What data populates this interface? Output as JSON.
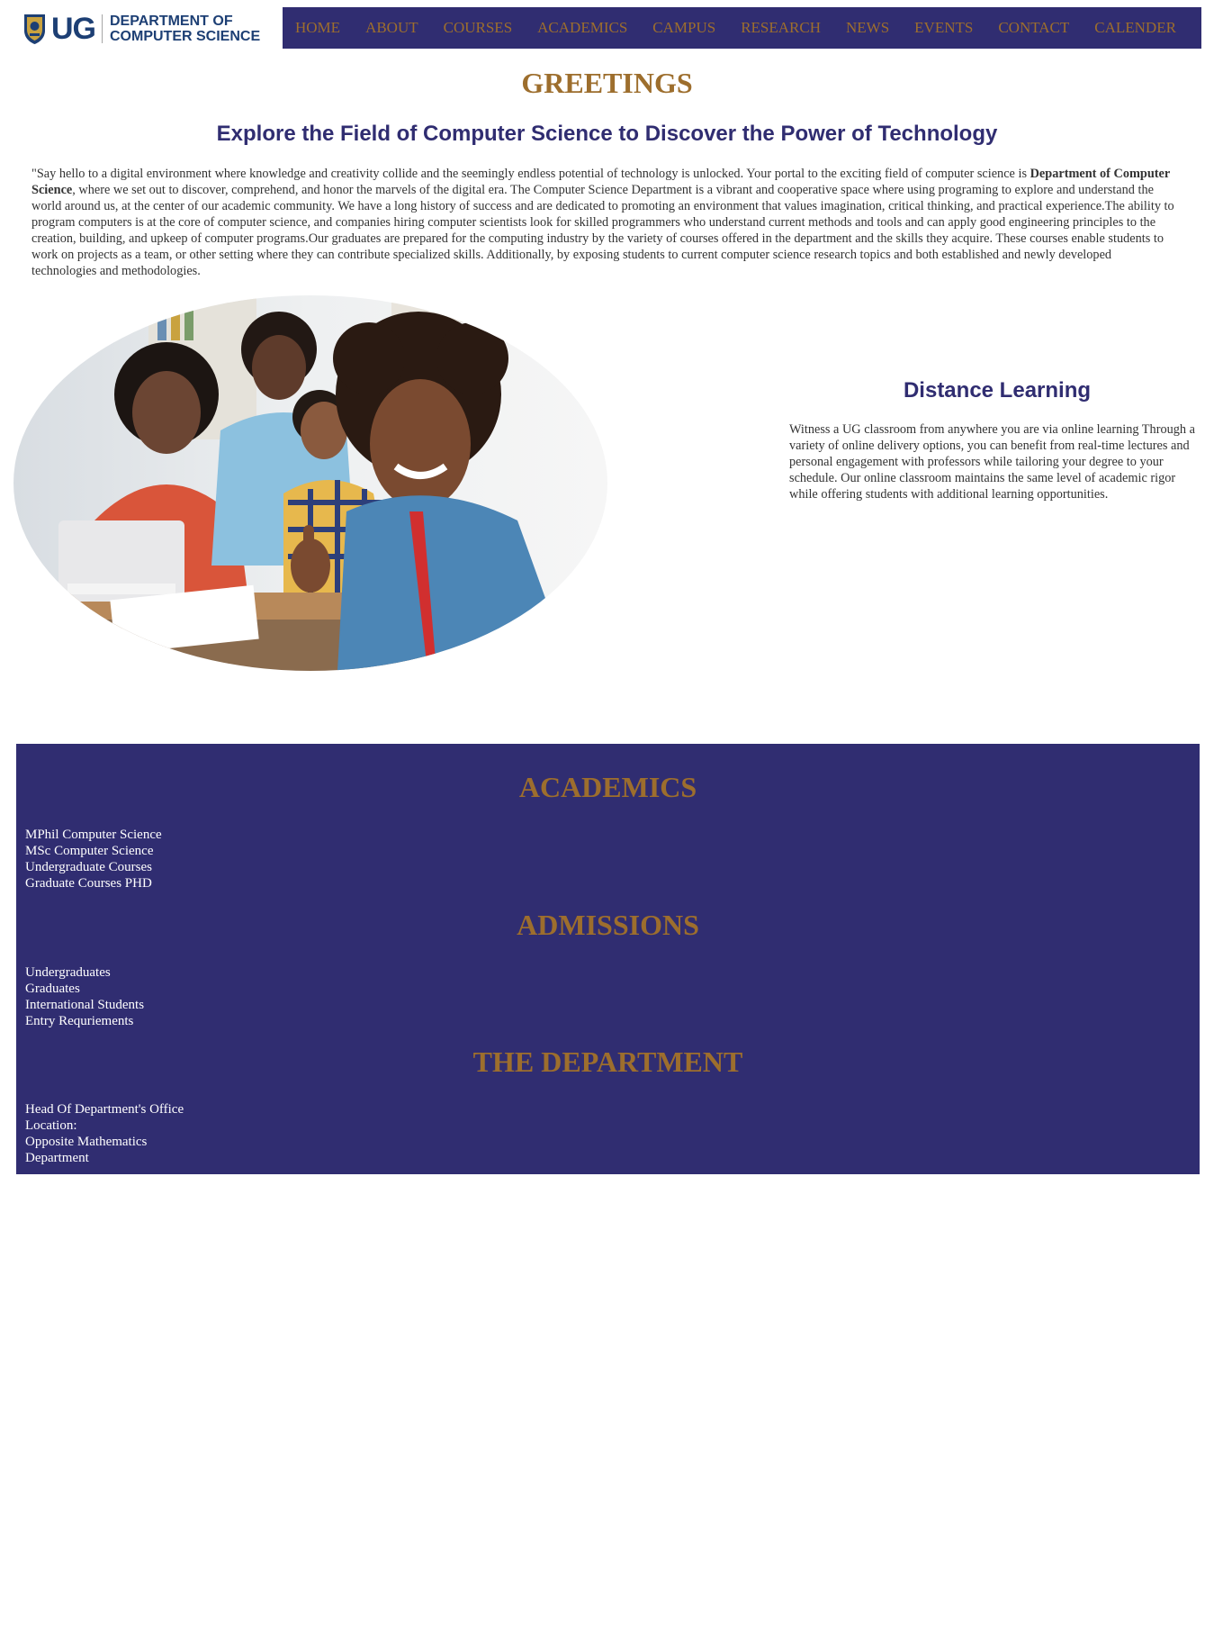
{
  "logo": {
    "short": "UG",
    "line1": "DEPARTMENT OF",
    "line2": "COMPUTER SCIENCE"
  },
  "nav": {
    "items": [
      {
        "label": "HOME"
      },
      {
        "label": "ABOUT"
      },
      {
        "label": "COURSES"
      },
      {
        "label": "ACADEMICS"
      },
      {
        "label": "CAMPUS"
      },
      {
        "label": "RESEARCH"
      },
      {
        "label": "NEWS"
      },
      {
        "label": "EVENTS"
      },
      {
        "label": "CONTACT"
      },
      {
        "label": "CALENDER"
      }
    ]
  },
  "greeting": {
    "title": "GREETINGS",
    "subtitle": "Explore the Field of Computer Science to Discover the Power of Technology",
    "intro_before": "\"Say hello to a digital environment where knowledge and creativity collide and the seemingly endless potential of technology is unlocked. Your portal to the exciting field of computer science is ",
    "intro_bold": "Department of Computer Science",
    "intro_after": ", where we set out to discover, comprehend, and honor the marvels of the digital era. The Computer Science Department is a vibrant and cooperative space where using programing to explore and understand the world around us, at the center of our academic community. We have a long history of success and are dedicated to promoting an environment that values imagination, critical thinking, and practical experience.The ability to program computers is at the core of computer science, and companies hiring computer scientists look for skilled programmers who understand current methods and tools and can apply good engineering principles to the creation, building, and upkeep of computer programs.Our graduates are prepared for the computing industry by the variety of courses offered in the department and the skills they acquire. These courses enable students to work on  projects as a team,  or other setting where they can contribute specialized skills. Additionally, by exposing students to current computer science research topics and both established and newly developed technologies and methodologies."
  },
  "distance": {
    "title": "Distance Learning",
    "text": "Witness a UG classroom from anywhere you are via online learning Through a variety of online delivery options, you can benefit from real-time lectures and personal engagement with professors while tailoring your degree to your schedule. Our online classroom maintains the same level of academic rigor while offering students with additional learning opportunities."
  },
  "footer": {
    "academics": {
      "title": "ACADEMICS",
      "items": [
        "MPhil Computer Science",
        "MSc Computer Science",
        "Undergraduate Courses",
        "Graduate Courses PHD"
      ]
    },
    "admissions": {
      "title": "ADMISSIONS",
      "items": [
        "Undergraduates",
        "Graduates",
        "International Students",
        "Entry Requriements"
      ]
    },
    "department": {
      "title": "THE DEPARTMENT",
      "lines": [
        "Head Of Department's Office",
        "Location:",
        "Opposite Mathematics",
        "Department"
      ]
    }
  },
  "colors": {
    "navy": "#302d71",
    "gold": "#9d6e2d",
    "logo_blue": "#1d3f74"
  },
  "icons": {
    "crest": "ug-crest-icon"
  }
}
